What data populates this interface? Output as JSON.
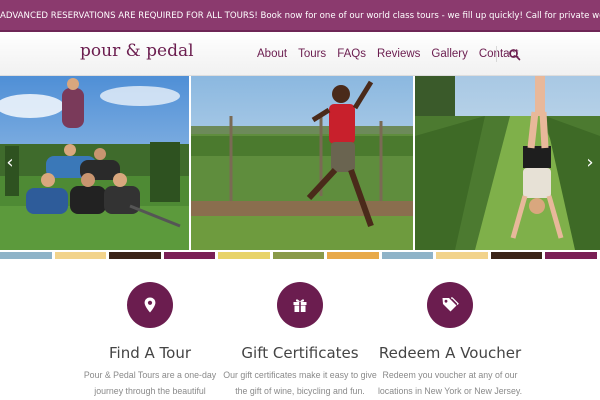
{
  "announcement": "ADVANCED RESERVATIONS ARE REQUIRED FOR ALL TOURS! Book now for one of our world class tours - we fill up quickly! Call for private weekday events!",
  "brand": {
    "logo": "pour & pedal"
  },
  "nav": {
    "items": [
      {
        "label": "About"
      },
      {
        "label": "Tours"
      },
      {
        "label": "FAQs"
      },
      {
        "label": "Reviews"
      },
      {
        "label": "Gallery"
      },
      {
        "label": "Contact"
      }
    ],
    "search_icon": "search-icon"
  },
  "slider": {
    "prev_glyph": "‹",
    "next_glyph": "›",
    "slides": [
      "group-pyramid-vineyard-photo",
      "jumping-man-vineyard-photo",
      "handstand-vineyard-photo"
    ]
  },
  "stripe_colors": [
    "#8fb3c8",
    "#f2d38c",
    "#3b2418",
    "#7a1f55",
    "#e8d36a",
    "#8a9a4a",
    "#e8a94a",
    "#8fb3c8",
    "#f2d38c",
    "#3b2418",
    "#7a1f55"
  ],
  "features": [
    {
      "icon": "map-pin-icon",
      "title": "Find A Tour",
      "text_lines": [
        "Pour & Pedal Tours are a one-day",
        "journey through the beautiful"
      ]
    },
    {
      "icon": "gift-icon",
      "title": "Gift Certificates",
      "text_lines": [
        "Our gift certificates make it easy to give",
        "the gift of wine, bicycling and fun."
      ]
    },
    {
      "icon": "tags-icon",
      "title": "Redeem A Voucher",
      "text_lines": [
        "Redeem you voucher at any of our",
        "locations in New York or New Jersey."
      ]
    }
  ],
  "colors": {
    "brand": "#6b1d4f",
    "topbar": "#8b3a6e"
  }
}
